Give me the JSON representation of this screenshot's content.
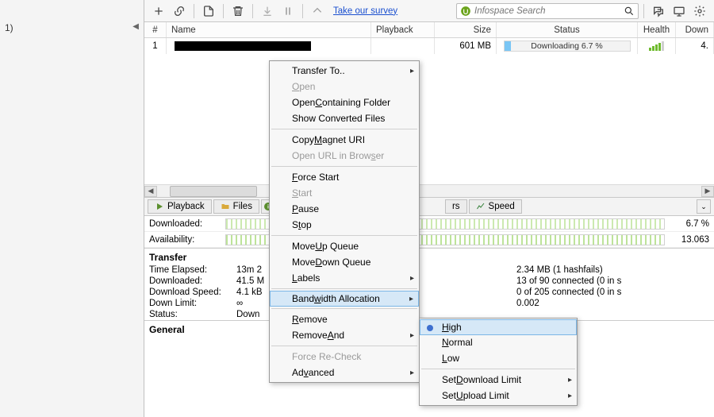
{
  "sidebar": {
    "label_row1": "1)"
  },
  "search_placeholder": "Infospace Search",
  "survey_link": "Take our survey",
  "columns": {
    "n": "#",
    "name": "Name",
    "playback": "Playback",
    "size": "Size",
    "status": "Status",
    "health": "Health",
    "down": "Down"
  },
  "row": {
    "n": "1",
    "size": "601 MB",
    "status_text": "Downloading 6.7 %",
    "down": "4."
  },
  "lower_tabs": {
    "playback": "Playback",
    "files": "Files",
    "ers_partial": "rs",
    "speed": "Speed"
  },
  "piecebars": {
    "downloaded_label": "Downloaded:",
    "downloaded_value": "6.7 %",
    "availability_label": "Availability:",
    "availability_value": "13.063"
  },
  "sections": {
    "transfer": "Transfer",
    "general": "General"
  },
  "transfer": {
    "time_elapsed": {
      "k": "Time Elapsed:",
      "v": "13m 2"
    },
    "downloaded": {
      "k": "Downloaded:",
      "v": "41.5 M"
    },
    "dl_speed": {
      "k": "Download Speed:",
      "v": "4.1 kB"
    },
    "down_limit": {
      "k": "Down Limit:",
      "v": "∞"
    },
    "status": {
      "k": "Status:",
      "v": "Down"
    },
    "wasted": {
      "v": "2.34 MB (1 hashfails)"
    },
    "peers": {
      "v": "13 of 90 connected (0 in s"
    },
    "seeds": {
      "v": "0 of 205 connected (0 in s"
    },
    "ratio": {
      "v": "0.002"
    }
  },
  "ctx_main": [
    {
      "label": "Transfer To..",
      "sub": true
    },
    {
      "label": "Open",
      "u": [
        0
      ],
      "disabled": true
    },
    {
      "label": "Open Containing Folder",
      "u": [
        5
      ]
    },
    {
      "label": "Show Converted Files"
    },
    {
      "sep": true
    },
    {
      "label": "Copy Magnet URI",
      "u": [
        5
      ]
    },
    {
      "label": "Open URL in Browser",
      "u": [
        16
      ],
      "disabled": true
    },
    {
      "sep": true
    },
    {
      "label": "Force Start",
      "u": [
        0
      ]
    },
    {
      "label": "Start",
      "u": [
        0
      ],
      "disabled": true
    },
    {
      "label": "Pause",
      "u": [
        0
      ]
    },
    {
      "label": "Stop",
      "u": [
        1
      ]
    },
    {
      "sep": true
    },
    {
      "label": "Move Up Queue",
      "u": [
        5
      ]
    },
    {
      "label": "Move Down Queue",
      "u": [
        5
      ]
    },
    {
      "label": "Labels",
      "u": [
        0
      ],
      "sub": true
    },
    {
      "sep": true
    },
    {
      "label": "Bandwidth Allocation",
      "u": [
        4
      ],
      "sub": true,
      "hover": true
    },
    {
      "sep": true
    },
    {
      "label": "Remove",
      "u": [
        0
      ]
    },
    {
      "label": "Remove And",
      "u": [
        7
      ],
      "sub": true
    },
    {
      "sep": true
    },
    {
      "label": "Force Re-Check",
      "disabled": true
    },
    {
      "label": "Advanced",
      "u": [
        2
      ],
      "sub": true
    }
  ],
  "ctx_sub": [
    {
      "label": "High",
      "u": [
        0
      ],
      "bullet": true,
      "hover": true
    },
    {
      "label": "Normal",
      "u": [
        0
      ]
    },
    {
      "label": "Low",
      "u": [
        0
      ]
    },
    {
      "sep": true
    },
    {
      "label": "Set Download Limit",
      "u": [
        4
      ],
      "sub": true
    },
    {
      "label": "Set Upload Limit",
      "u": [
        4
      ],
      "sub": true
    }
  ]
}
